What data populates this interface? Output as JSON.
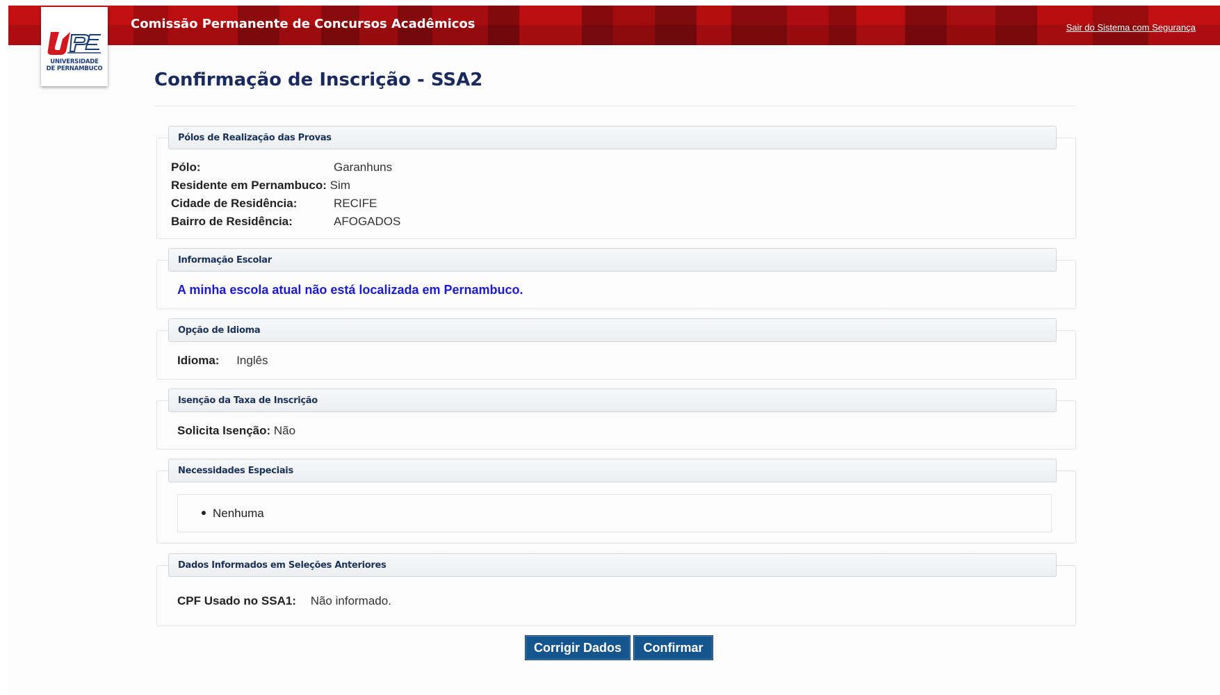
{
  "header": {
    "title": "Comissão Permanente de Concursos Acadêmicos",
    "logout_link": "Sair do Sistema com Segurança"
  },
  "logo": {
    "line1": "UNIVERSIDADE",
    "line2": "DE PERNAMBUCO",
    "mark": "UPE"
  },
  "page": {
    "title": "Confirmação de Inscrição - SSA2"
  },
  "sections": {
    "polos": {
      "heading": "Pólos de Realização das Provas",
      "polo_label": "Pólo:",
      "polo_value": "Garanhuns",
      "residente_label": "Residente em Pernambuco:",
      "residente_value": "Sim",
      "cidade_label": "Cidade de Residência:",
      "cidade_value": "RECIFE",
      "bairro_label": "Bairro de Residência:",
      "bairro_value": "AFOGADOS"
    },
    "escolar": {
      "heading": "Informação Escolar",
      "note": "A minha escola atual não está localizada em Pernambuco."
    },
    "idioma": {
      "heading": "Opção de Idioma",
      "label": "Idioma:",
      "value": "Inglês"
    },
    "isencao": {
      "heading": "Isenção da Taxa de Inscrição",
      "label": "Solicita Isenção:",
      "value": "Não"
    },
    "necessidades": {
      "heading": "Necessidades Especiais",
      "items": [
        "Nenhuma"
      ]
    },
    "anteriores": {
      "heading": "Dados Informados em Seleções Anteriores",
      "label": "CPF Usado no SSA1:",
      "value": "Não informado."
    }
  },
  "actions": {
    "corrigir": "Corrigir Dados",
    "confirmar": "Confirmar"
  },
  "colors": {
    "banner_red": "#c40f12",
    "title_navy": "#1b2a5e",
    "button_blue": "#15558d",
    "note_blue": "#1a1ad6"
  }
}
